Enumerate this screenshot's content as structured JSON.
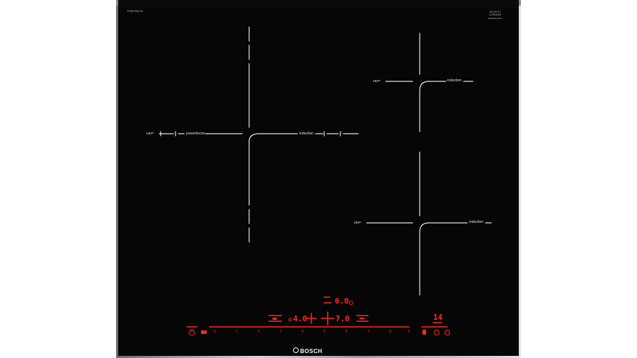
{
  "hob": {
    "model_number": "PXE675DC1E",
    "glass_brand": [
      "SCHOTT",
      "CERAN®"
    ],
    "glass_code": "MS0002020",
    "brand_name": "BOSCH"
  },
  "zones": {
    "flex_left_boost": "powerboost",
    "flex_left_induction": "induction",
    "right_top_induction": "induction",
    "right_bottom_induction": "induction",
    "zone_icon_text": "ᴜʀᴊᵐ"
  },
  "controls": {
    "timer_display": "6.0",
    "left_zone_level": "4.0",
    "center_zone_level": "7.0",
    "right_display": "14",
    "slider_scale": [
      "0",
      "1",
      "2",
      "3",
      "4",
      "5",
      "6",
      "7",
      "8",
      "9"
    ],
    "colors": {
      "accent_red": "#ff2a1f",
      "glass": "#060606",
      "print": "#d8d8d8"
    },
    "icons": [
      "power-icon",
      "child-lock-icon",
      "timer-icon",
      "settings-icon",
      "keep-warm-icon",
      "clock-icon"
    ]
  }
}
